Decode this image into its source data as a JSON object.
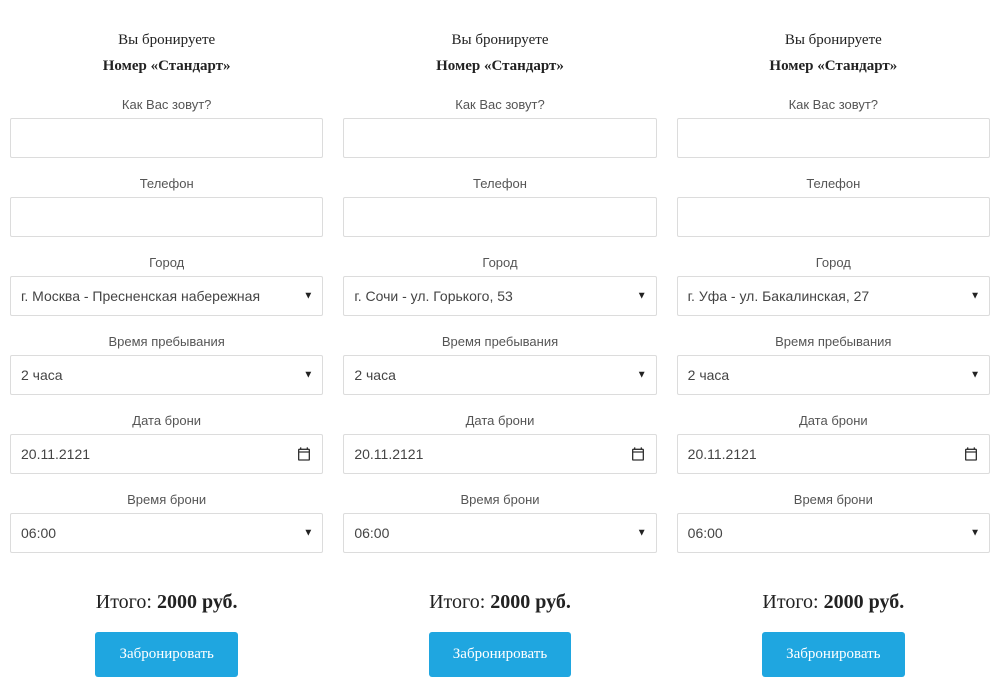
{
  "common": {
    "heading_line1": "Вы бронируете",
    "heading_line2": "Номер «Стандарт»",
    "label_name": "Как Вас зовут?",
    "label_phone": "Телефон",
    "label_city": "Город",
    "label_duration": "Время пребывания",
    "label_date": "Дата брони",
    "label_time": "Время брони",
    "total_label": "Итого:",
    "currency": "руб.",
    "button": "Забронировать"
  },
  "columns": [
    {
      "name_value": "",
      "phone_value": "",
      "city": "г. Москва - Пресненская набережная",
      "duration": "2 часа",
      "date": "20.11.2121",
      "time": "06:00",
      "total_amount": "2000"
    },
    {
      "name_value": "",
      "phone_value": "",
      "city": "г. Сочи - ул. Горького, 53",
      "duration": "2 часа",
      "date": "20.11.2121",
      "time": "06:00",
      "total_amount": "2000"
    },
    {
      "name_value": "",
      "phone_value": "",
      "city": "г. Уфа - ул. Бакалинская, 27",
      "duration": "2 часа",
      "date": "20.11.2121",
      "time": "06:00",
      "total_amount": "2000"
    }
  ]
}
